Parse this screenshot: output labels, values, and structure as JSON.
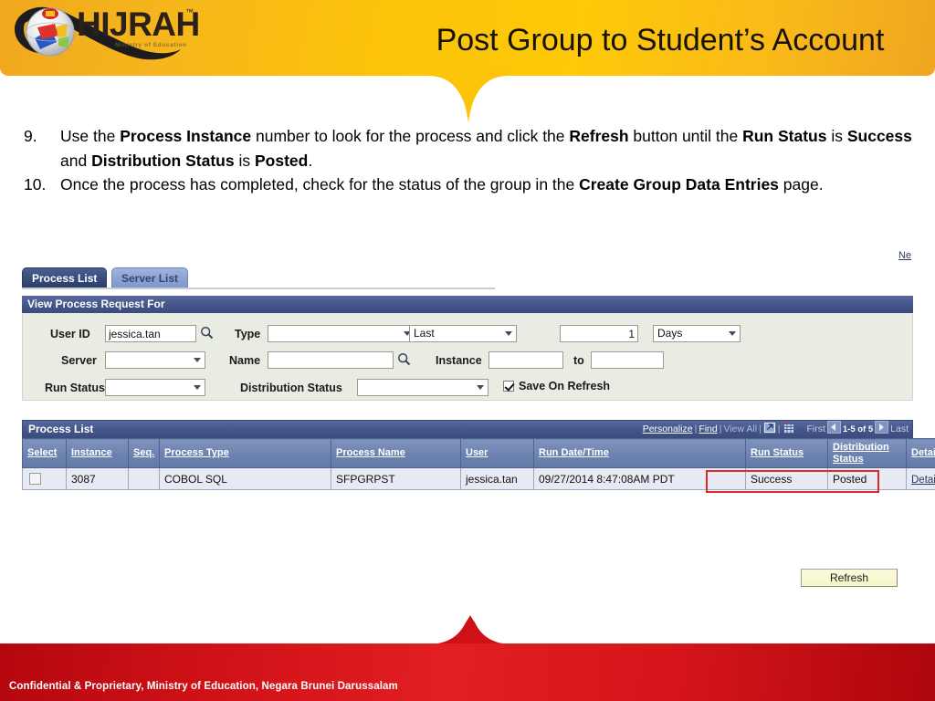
{
  "brand": {
    "logo_name": "HIJRAH",
    "logo_tm": "™",
    "logo_tagline": "Ministry of Education"
  },
  "header": {
    "title": "Post Group to Student’s Account",
    "bg_color": "#fcc408"
  },
  "steps": [
    {
      "number": "9.",
      "parts": [
        {
          "t": "Use the ",
          "b": false
        },
        {
          "t": "Process Instance",
          "b": true
        },
        {
          "t": " number to look for the process and click the ",
          "b": false
        },
        {
          "t": "Refresh",
          "b": true
        },
        {
          "t": " button until the ",
          "b": false
        },
        {
          "t": "Run Status",
          "b": true
        },
        {
          "t": " is ",
          "b": false
        },
        {
          "t": "Success",
          "b": true
        },
        {
          "t": " and ",
          "b": false
        },
        {
          "t": "Distribution Status",
          "b": true
        },
        {
          "t": " is ",
          "b": false
        },
        {
          "t": "Posted",
          "b": true
        },
        {
          "t": ".",
          "b": false
        }
      ]
    },
    {
      "number": "10.",
      "parts": [
        {
          "t": "Once the process has completed, check for the status of the group in the ",
          "b": false
        },
        {
          "t": "Create Group Data Entries",
          "b": true
        },
        {
          "t": " page.",
          "b": false
        }
      ]
    }
  ],
  "peoplesoft": {
    "new_window_link": "Ne",
    "tabs": [
      {
        "label": "Process List",
        "active": true
      },
      {
        "label": "Server List",
        "active": false
      }
    ],
    "section_title": "View Process Request For",
    "filters": {
      "user_id_label": "User ID",
      "user_id_value": "jessica.tan",
      "server_label": "Server",
      "server_value": "",
      "run_status_label": "Run Status",
      "run_status_value": "",
      "type_label": "Type",
      "type_value": "",
      "last_value": "Last",
      "days_count_value": "1",
      "days_unit_value": "Days",
      "name_label": "Name",
      "name_value": "",
      "instance_label": "Instance",
      "instance_from_value": "",
      "to_label": "to",
      "instance_to_value": "",
      "distribution_status_label": "Distribution Status",
      "distribution_status_value": "",
      "save_on_refresh_label": "Save On Refresh",
      "save_on_refresh_checked": true,
      "refresh_button": "Refresh"
    },
    "grid": {
      "title": "Process List",
      "actions": {
        "personalize": "Personalize",
        "find": "Find",
        "view_all": "View All",
        "download_icon": "download-icon",
        "spreadsheet_icon": "spreadsheet-icon"
      },
      "pager": {
        "first": "First",
        "range": "1-5 of 5",
        "last": "Last"
      },
      "columns": [
        "Select",
        "Instance",
        "Seq.",
        "Process Type",
        "Process Name",
        "User",
        "Run Date/Time",
        "Run Status",
        "Distribution Status",
        "Details"
      ],
      "rows": [
        {
          "select": "",
          "instance": "3087",
          "seq": "",
          "process_type": "COBOL SQL",
          "process_name": "SFPGRPST",
          "user": "jessica.tan",
          "run_datetime": "09/27/2014  8:47:08AM PDT",
          "run_status": "Success",
          "distribution_status": "Posted",
          "details": "Details"
        }
      ],
      "highlight_color": "#e02a26"
    }
  },
  "footer": {
    "text": "Confidential & Proprietary, Ministry of Education, Negara Brunei Darussalam",
    "bg_color": "#d5151a"
  }
}
